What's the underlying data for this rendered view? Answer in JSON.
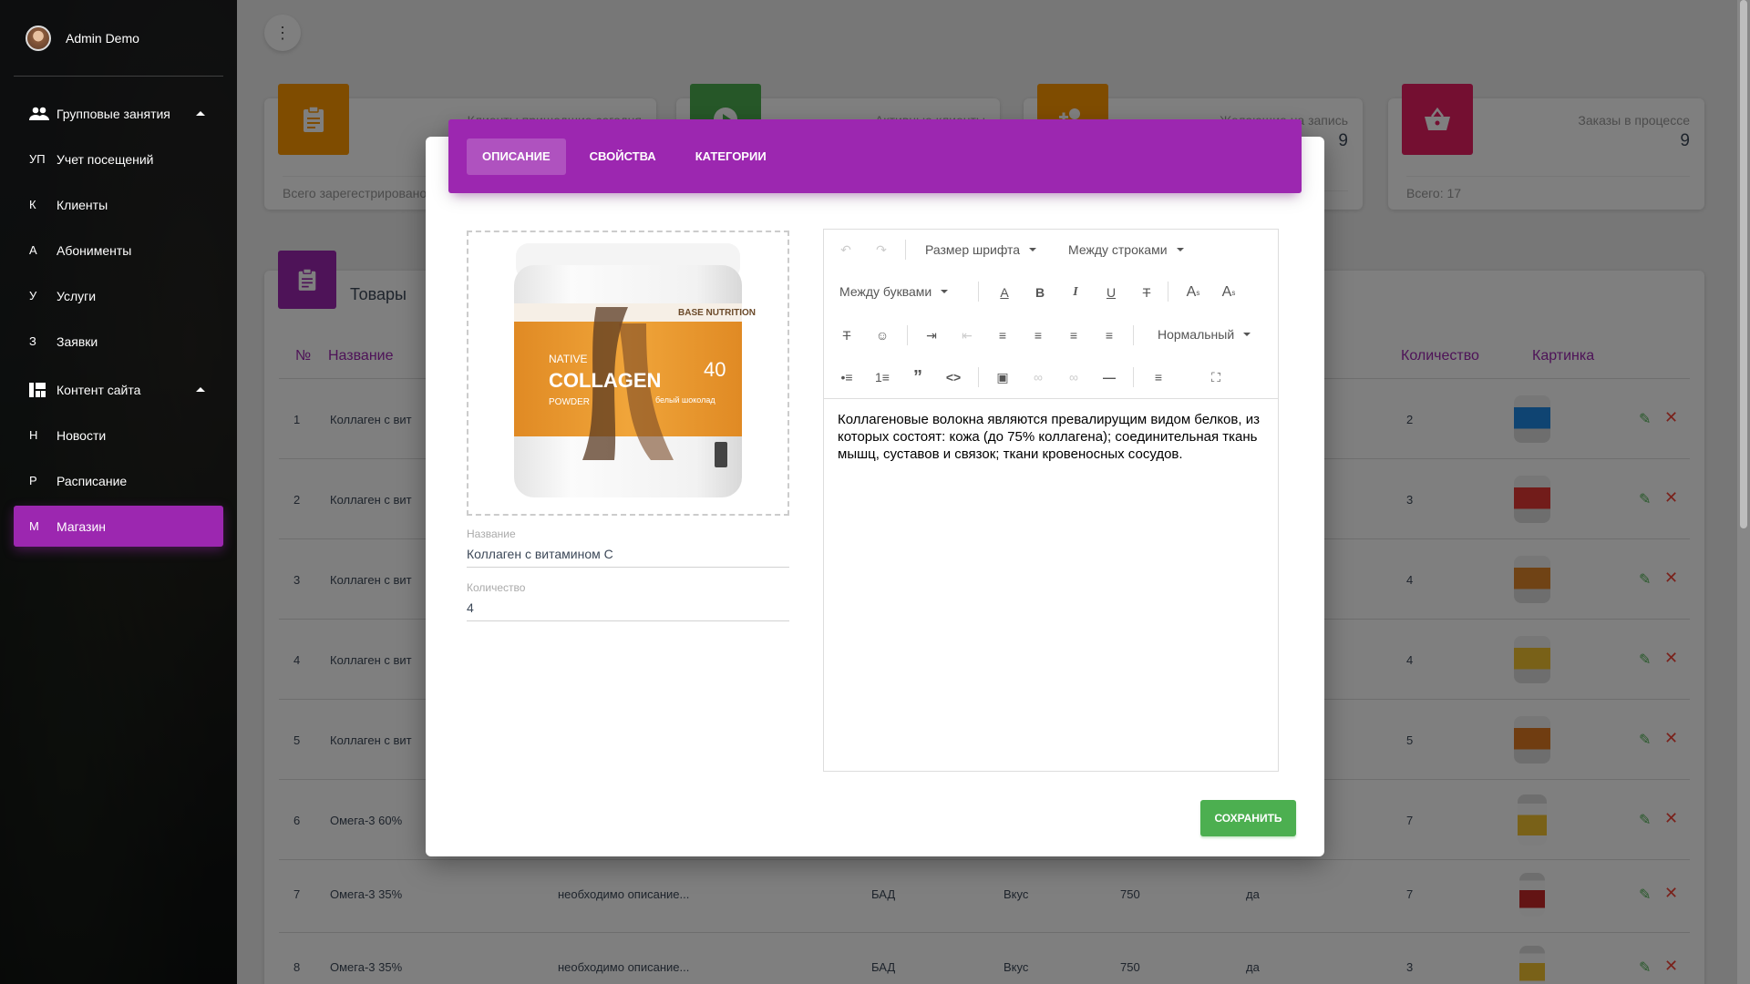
{
  "sidebar": {
    "user_name": "Admin Demo",
    "items": [
      {
        "abbr": "",
        "icon": "people-icon",
        "label": "Групповые занятия",
        "expanded": true
      },
      {
        "abbr": "УП",
        "label": "Учет посещений"
      },
      {
        "abbr": "К",
        "label": "Клиенты"
      },
      {
        "abbr": "А",
        "label": "Абонименты"
      },
      {
        "abbr": "У",
        "label": "Услуги"
      },
      {
        "abbr": "З",
        "label": "Заявки"
      },
      {
        "abbr": "",
        "icon": "dashboard-icon",
        "label": "Контент сайта",
        "expanded": true
      },
      {
        "abbr": "Н",
        "label": "Новости"
      },
      {
        "abbr": "Р",
        "label": "Расписание"
      },
      {
        "abbr": "М",
        "label": "Магазин",
        "active": true
      }
    ]
  },
  "stats": [
    {
      "title": "Клиенты пришедшие сегодня",
      "value": "",
      "footer": "Всего зарегестрировано",
      "color": "#ff9800",
      "icon": "clipboard-icon"
    },
    {
      "title": "Активные клиенты",
      "value": "",
      "footer": "",
      "color": "#4caf50",
      "icon": "play-icon"
    },
    {
      "title": "Желающие на запись",
      "value": "9",
      "footer": "",
      "color": "#ff9800",
      "icon": "person-add-icon"
    },
    {
      "title": "Заказы в процессе",
      "value": "9",
      "footer": "Всего: 17",
      "color": "#e91e63",
      "icon": "basket-icon"
    }
  ],
  "table": {
    "title": "Товары",
    "headers": {
      "num": "№",
      "name": "Название",
      "qty": "Количество",
      "picture": "Картинка"
    },
    "rows": [
      {
        "num": "1",
        "name": "Коллаген с вит",
        "qty": "2"
      },
      {
        "num": "2",
        "name": "Коллаген с вит",
        "qty": "3"
      },
      {
        "num": "3",
        "name": "Коллаген с вит",
        "qty": "4"
      },
      {
        "num": "4",
        "name": "Коллаген с вит",
        "qty": "4"
      },
      {
        "num": "5",
        "name": "Коллаген с вит",
        "qty": "5"
      },
      {
        "num": "6",
        "name": "Омега-3 60%",
        "qty": "7"
      },
      {
        "num": "7",
        "name": "Омега-3 35%",
        "desc": "необходимо описание...",
        "type": "БАД",
        "prop": "Вкус",
        "weight": "750",
        "flag": "да",
        "qty": "7"
      },
      {
        "num": "8",
        "name": "Омега-3 35%",
        "desc": "необходимо описание...",
        "type": "БАД",
        "prop": "Вкус",
        "weight": "750",
        "flag": "да",
        "qty": "3"
      }
    ]
  },
  "modal": {
    "tabs": [
      "Описание",
      "Свойства",
      "Категории"
    ],
    "active_tab": 0,
    "product_image": {
      "brand": "BASE NUTRITION",
      "line1": "NATIVE",
      "line2": "COLLAGEN",
      "line3": "POWDER",
      "badge": "40",
      "flavor": "белый шоколад"
    },
    "fields": {
      "name_label": "Название",
      "name_value": "Коллаген с витамином С",
      "qty_label": "Количество",
      "qty_value": "4"
    },
    "editor": {
      "font_size": "Размер шрифта",
      "line_height": "Между строками",
      "letter_spacing": "Между буквами",
      "paragraph": "Нормальный",
      "content": "Коллагеновые волокна являются превалирущим видом белков, из которых состоят: кожа (до 75% коллагена); соединительная ткань мышц, суставов и связок; ткани кровеносных сосудов."
    },
    "save_label": "Сохранить"
  }
}
